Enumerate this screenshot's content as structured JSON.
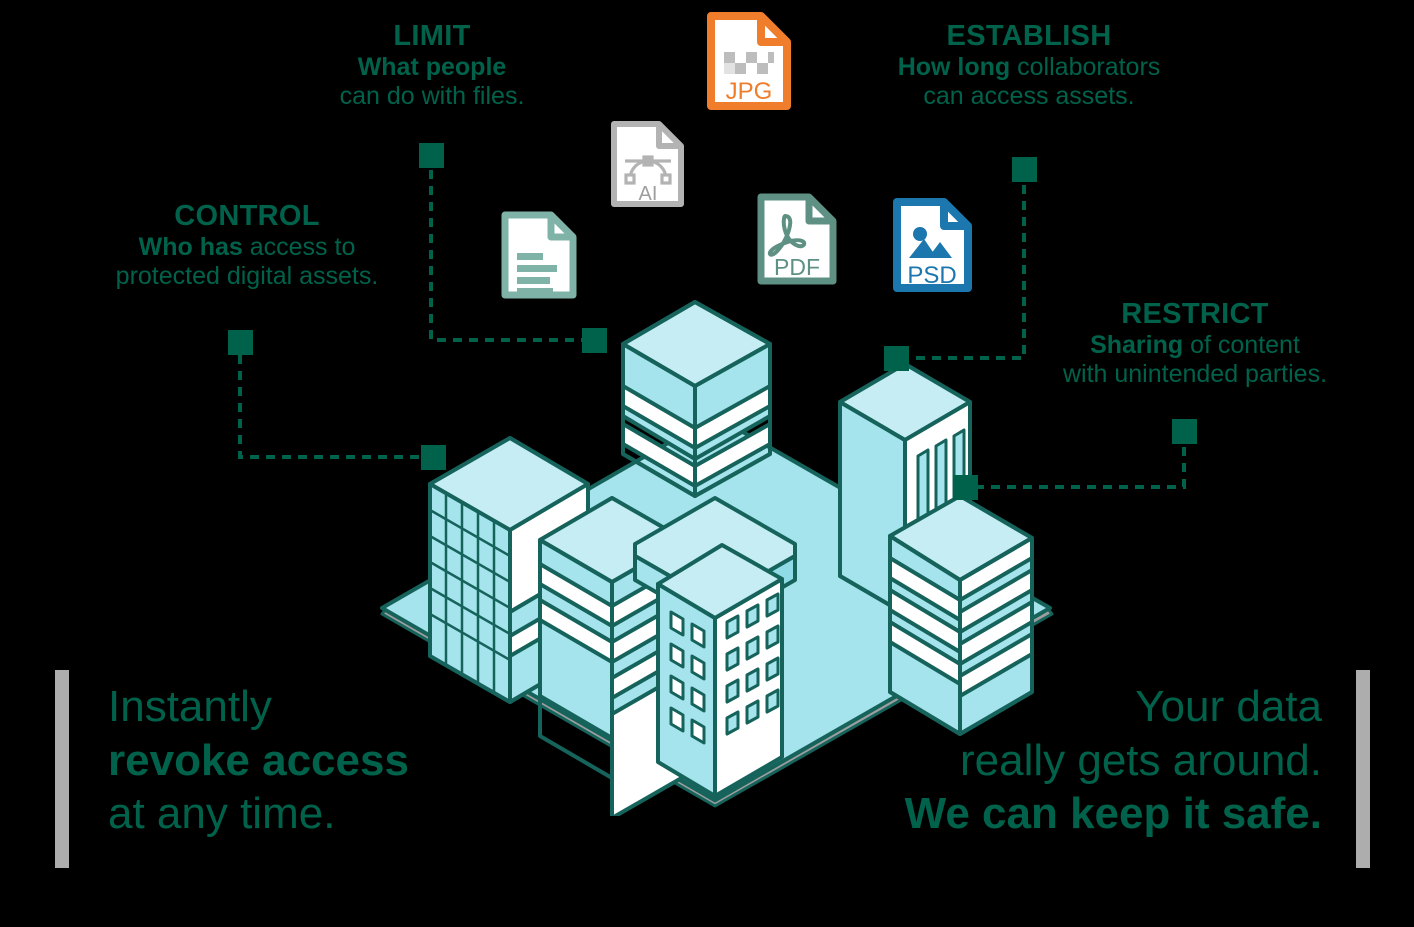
{
  "graphic": {
    "background_color": "#000000",
    "accent_color": "#00624B",
    "building_fill": "#A5E4EC",
    "building_stroke": "#16635C",
    "rule_bar_color": "#ADADAD"
  },
  "callouts": [
    {
      "id": "control",
      "title": "CONTROL",
      "body_strong": "Who has",
      "body_rest": " access to",
      "body_line2": "protected digital assets."
    },
    {
      "id": "limit",
      "title": "LIMIT",
      "body_strong": "What people",
      "body_rest": "",
      "body_line2": "can do with files."
    },
    {
      "id": "establish",
      "title": "ESTABLISH",
      "body_strong": "How long",
      "body_rest": " collaborators",
      "body_line2": "can access assets."
    },
    {
      "id": "restrict",
      "title": "RESTRICT",
      "body_strong": "Sharing",
      "body_rest": " of content",
      "body_line2": "with unintended parties."
    }
  ],
  "statements": {
    "left": {
      "line1": "Instantly",
      "line2": "revoke access",
      "line3": "at any time."
    },
    "right": {
      "line1": "Your data",
      "line2": "really gets around.",
      "line3": "We can keep it safe."
    }
  },
  "file_icons": [
    {
      "id": "doc",
      "label": "",
      "color": "#7FB3A8",
      "glyph": "document-lines"
    },
    {
      "id": "ai",
      "label": "AI",
      "color": "#B3B3B3",
      "glyph": "bezier-curve"
    },
    {
      "id": "jpg",
      "label": "JPG",
      "color": "#F07D2B",
      "glyph": "checkerboard"
    },
    {
      "id": "pdf",
      "label": "PDF",
      "color": "#5E9184",
      "glyph": "acrobat-a"
    },
    {
      "id": "psd",
      "label": "PSD",
      "color": "#1B77AE",
      "glyph": "image-mountain"
    }
  ]
}
